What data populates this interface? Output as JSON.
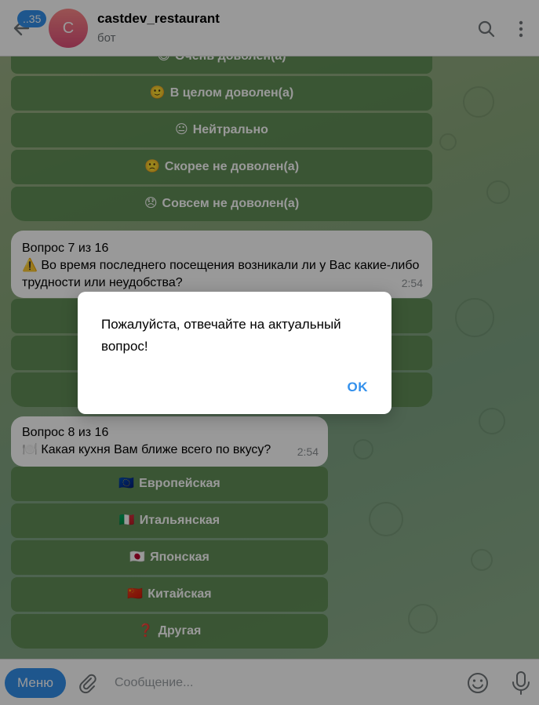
{
  "header": {
    "unread_count": "..35",
    "avatar_letter": "C",
    "title": "castdev_restaurant",
    "subtitle": "бот"
  },
  "q6_buttons": [
    {
      "emoji": "😄",
      "label": "Очень доволен(а)"
    },
    {
      "emoji": "🙂",
      "label": "В целом доволен(а)"
    },
    {
      "emoji": "😐",
      "label": "Нейтрально"
    },
    {
      "emoji": "🙁",
      "label": "Скорее не доволен(а)"
    },
    {
      "emoji": "😞",
      "label": "Совсем не доволен(а)"
    }
  ],
  "q7": {
    "heading": "Вопрос 7 из 16",
    "emoji": "⚠️",
    "text": "Во время последнего посещения возникали ли у Вас какие-либо трудности или неудобства?",
    "time": "2:54"
  },
  "q8": {
    "heading": "Вопрос 8 из 16",
    "emoji": "🍽️",
    "text": "Какая кухня Вам ближе всего по вкусу?",
    "time": "2:54"
  },
  "q8_buttons": [
    {
      "emoji": "🇪🇺",
      "label": "Европейская"
    },
    {
      "emoji": "🇮🇹",
      "label": "Итальянская"
    },
    {
      "emoji": "🇯🇵",
      "label": "Японская"
    },
    {
      "emoji": "🇨🇳",
      "label": "Китайская"
    },
    {
      "emoji": "❓",
      "label": "Другая"
    }
  ],
  "dialog": {
    "message": "Пожалуйста, отвечайте на актуальный вопрос!",
    "ok_label": "OK"
  },
  "input_bar": {
    "menu_label": "Меню",
    "placeholder": "Сообщение..."
  },
  "colors": {
    "accent": "#3390ec",
    "keyboard_button": "#5e8c54",
    "chat_background": "#8aa87c"
  },
  "icons": [
    "back-arrow-icon",
    "search-icon",
    "more-vertical-icon",
    "attach-icon",
    "emoji-icon",
    "microphone-icon"
  ]
}
